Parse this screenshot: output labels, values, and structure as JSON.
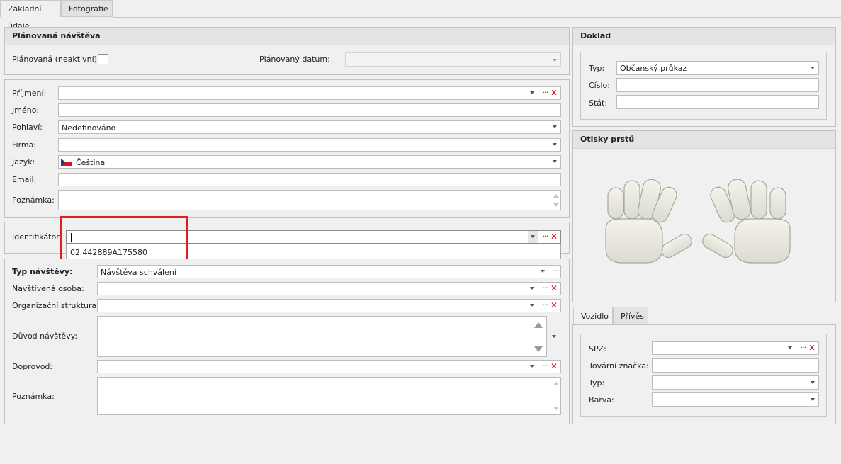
{
  "tabs": {
    "basic": "Základní údaje",
    "photo": "Fotografie"
  },
  "planned": {
    "title": "Plánovaná návštěva",
    "inactive_label": "Plánovaná (neaktivní):",
    "date_label": "Plánovaný datum:",
    "date_value": ""
  },
  "person": {
    "surname_label": "Příjmení:",
    "name_label": "Jméno:",
    "gender_label": "Pohlaví:",
    "gender_value": "Nedefinováno",
    "company_label": "Firma:",
    "language_label": "Jazyk:",
    "language_value": "Čeština",
    "email_label": "Email:",
    "note_label": "Poznámka:"
  },
  "identifier": {
    "label": "Identifikátor:",
    "value": "",
    "suggestion": "02 442889A175580"
  },
  "visit": {
    "type_label": "Typ návštěvy:",
    "type_value": "Návštěva schválení",
    "person_label": "Navštívená osoba:",
    "org_label": "Organizační struktura:",
    "reason_label": "Důvod návštěvy:",
    "escort_label": "Doprovod:",
    "note_label": "Poznámka:"
  },
  "doc": {
    "title": "Doklad",
    "type_label": "Typ:",
    "type_value": "Občanský průkaz",
    "number_label": "Číslo:",
    "state_label": "Stát:"
  },
  "fingerprints": {
    "title": "Otisky prstů"
  },
  "vehicle_tabs": {
    "vehicle": "Vozidlo",
    "trailer": "Přívěs"
  },
  "vehicle": {
    "plate_label": "SPZ:",
    "brand_label": "Tovární značka:",
    "type_label": "Typ:",
    "color_label": "Barva:"
  },
  "icons": {
    "ellipsis": "···",
    "clear": "✕"
  },
  "colors": {
    "highlight": "#e02020",
    "clear_red": "#d01010",
    "hand_fill": "#ecebe2"
  }
}
